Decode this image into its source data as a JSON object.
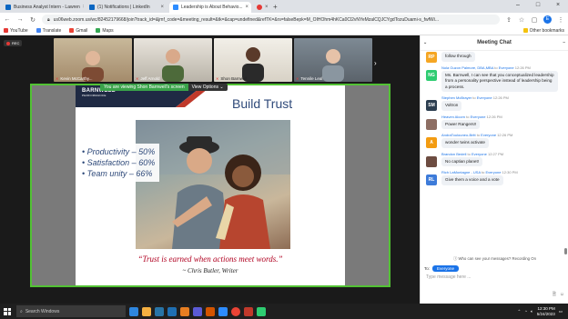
{
  "browser": {
    "tabs": [
      {
        "label": "Business Analyst Intern - Lawren",
        "color": "#0a66c2",
        "active": false
      },
      {
        "label": "(1) Notifications | LinkedIn",
        "color": "#0a66c2",
        "active": false
      },
      {
        "label": "Leadership is About Behavio...",
        "color": "#2d8cff",
        "active": true
      },
      {
        "label": "",
        "color": "#e53935",
        "active": false
      }
    ],
    "new_tab": "+",
    "url": "us06web.zoom.us/wc/82452179668/join?track_id=&jmf_code=&meeting_result=&tk=&cap=undefined&refTK=&rs=falseBepk=M_OIHOhm4hKCa0Cl2vNYeMzalCQJCYgdTozuDuami-s_fwfWi...",
    "bookmarks": [
      {
        "label": "YouTube",
        "color": "#e53935"
      },
      {
        "label": "Translate",
        "color": "#4285f4"
      },
      {
        "label": "Gmail",
        "color": "#ea4335"
      },
      {
        "label": "Maps",
        "color": "#34a853"
      }
    ],
    "other_bookmarks": "Other bookmarks",
    "profile_initial": "E"
  },
  "meeting": {
    "rec_label": "REC",
    "participants": [
      {
        "name": "Kevin McCarthy..."
      },
      {
        "name": "Jeff Arnold"
      },
      {
        "name": "Shon Barnwell"
      },
      {
        "name": "Tennile Leal"
      }
    ],
    "viewing_label": "You are viewing Shon Barnwell's screen",
    "view_options": "View Options"
  },
  "slide": {
    "logo": "BARNWELL",
    "logo_sub": "PERFORMANCE",
    "title": "Build Trust",
    "bullets": [
      "Productivity – 50%",
      "Satisfaction – 60%",
      "Team unity – 66%"
    ],
    "quote": "“Trust is earned when actions meet words.”",
    "attribution": "~ Chris Butler, Writer"
  },
  "chat": {
    "title": "Meeting Chat",
    "messages": [
      {
        "initials": "RP",
        "color": "#f5a623",
        "sender": "",
        "to": "",
        "time": "",
        "text": "follow through"
      },
      {
        "initials": "NG",
        "color": "#2ecc71",
        "sender": "Nola Guzon Palmore, DBA,MBA",
        "to": "Everyone",
        "time": "12:26 PM",
        "text": "Ms. Barnwell, I can see that you conceptualized leadership from a personality perspective instead of leadership being a process."
      },
      {
        "initials": "SM",
        "color": "#2c3e50",
        "sender": "Stephen McBrayer",
        "to": "Everyone",
        "time": "12:26 PM",
        "text": "Voltron"
      },
      {
        "initials": "",
        "color": "#8d6e63",
        "sender": "Heaven Alcorn",
        "to": "Everyone",
        "time": "12:26 PM",
        "text": "Power Rangers!!"
      },
      {
        "initials": "A",
        "color": "#f39c12",
        "sender": "AndraToulouneo-Britt",
        "to": "Everyone",
        "time": "12:26 PM",
        "text": "wonder twins activate"
      },
      {
        "initials": "",
        "color": "#6d4c41",
        "sender": "Brandon Bedell",
        "to": "Everyone",
        "time": "12:27 PM",
        "text": "No captian planet!"
      },
      {
        "initials": "RL",
        "color": "#3d7bd9",
        "sender": "Rich LaMontagne - USA",
        "to": "Everyone",
        "time": "12:30 PM",
        "text": "Give them a voice and a vote"
      }
    ],
    "to_word": "to",
    "who_can_see": "Who can see your messages? Recording On",
    "to_label": "To:",
    "recipient": "Everyone",
    "input_placeholder": "Type message here ..."
  },
  "taskbar": {
    "search_placeholder": "Search Windows",
    "time": "12:30 PM",
    "date": "5/24/2023",
    "apps": [
      "#2e86de",
      "#f5b041",
      "#2874a6",
      "#1f6fb2",
      "#e67e22",
      "#5b5bd6",
      "#d35400",
      "#2d8cff",
      "#ea4335",
      "#c0392b",
      "#2ecc71"
    ]
  }
}
